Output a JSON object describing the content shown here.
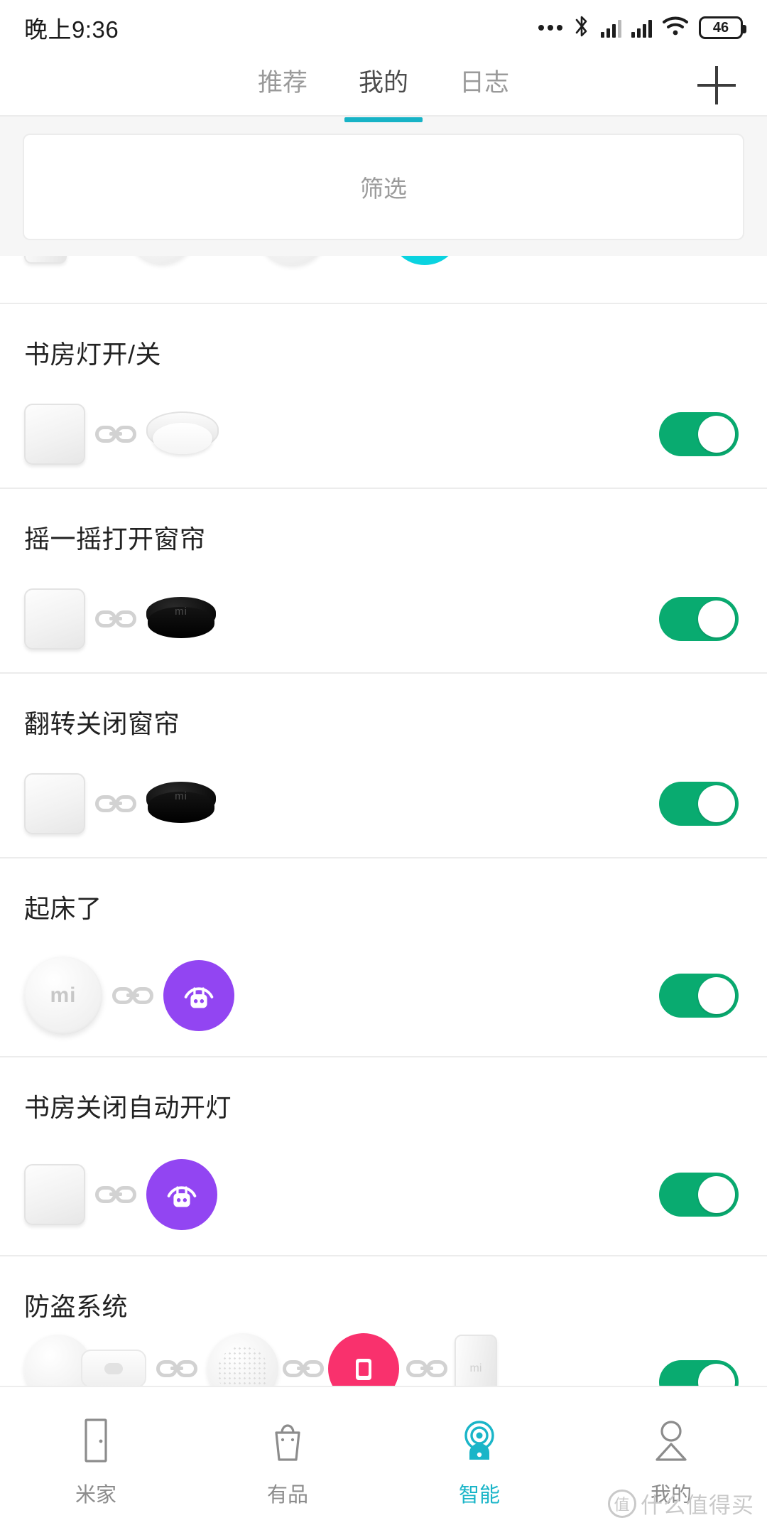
{
  "statusbar": {
    "time": "晚上9:36",
    "battery": "46",
    "icons": [
      "more-dots-icon",
      "bluetooth-icon",
      "signal-bars-icon",
      "signal-bars-icon",
      "wifi-icon",
      "battery-icon"
    ]
  },
  "header": {
    "tabs": [
      {
        "label": "推荐",
        "active": false
      },
      {
        "label": "我的",
        "active": true
      },
      {
        "label": "日志",
        "active": false
      }
    ],
    "add_button": "+",
    "accent_color": "#17b3c6"
  },
  "filter": {
    "label": "筛选"
  },
  "scenes": [
    {
      "title": "",
      "clipped": true,
      "devices": [
        "plug-device-icon",
        "sensor-round-icon",
        "sensor-mesh-icon",
        "cyan-circle-icon"
      ],
      "toggle_on": false
    },
    {
      "title": "书房灯开/关",
      "devices": [
        "wall-switch-icon",
        "ceiling-lamp-icon"
      ],
      "toggle_on": true
    },
    {
      "title": "摇一摇打开窗帘",
      "devices": [
        "wall-switch-icon",
        "black-puck-icon"
      ],
      "toggle_on": true
    },
    {
      "title": "翻转关闭窗帘",
      "devices": [
        "wall-switch-icon",
        "black-puck-icon"
      ],
      "toggle_on": true
    },
    {
      "title": "起床了",
      "devices": [
        "mi-button-icon",
        "ai-assistant-icon"
      ],
      "toggle_on": true
    },
    {
      "title": "书房关闭自动开灯",
      "devices": [
        "wall-switch-icon",
        "ai-assistant-icon"
      ],
      "toggle_on": true
    },
    {
      "title": "防盗系统",
      "clipped": true,
      "devices": [
        "sensor-round-icon",
        "small-pill-icon",
        "sensor-mesh-icon",
        "pink-camera-icon",
        "gateway-icon",
        "small-pill-icon"
      ],
      "toggle_on": true
    }
  ],
  "toggle_color": "#09ab70",
  "bottomnav": {
    "items": [
      {
        "label": "米家",
        "icon": "door-icon",
        "active": false
      },
      {
        "label": "有品",
        "icon": "shopping-bag-icon",
        "active": false
      },
      {
        "label": "智能",
        "icon": "camera-icon",
        "active": true
      },
      {
        "label": "我的",
        "icon": "person-icon",
        "active": false
      }
    ],
    "active_color": "#1ab5c8"
  },
  "watermark": {
    "text": "什么值得买",
    "logo": "值"
  }
}
